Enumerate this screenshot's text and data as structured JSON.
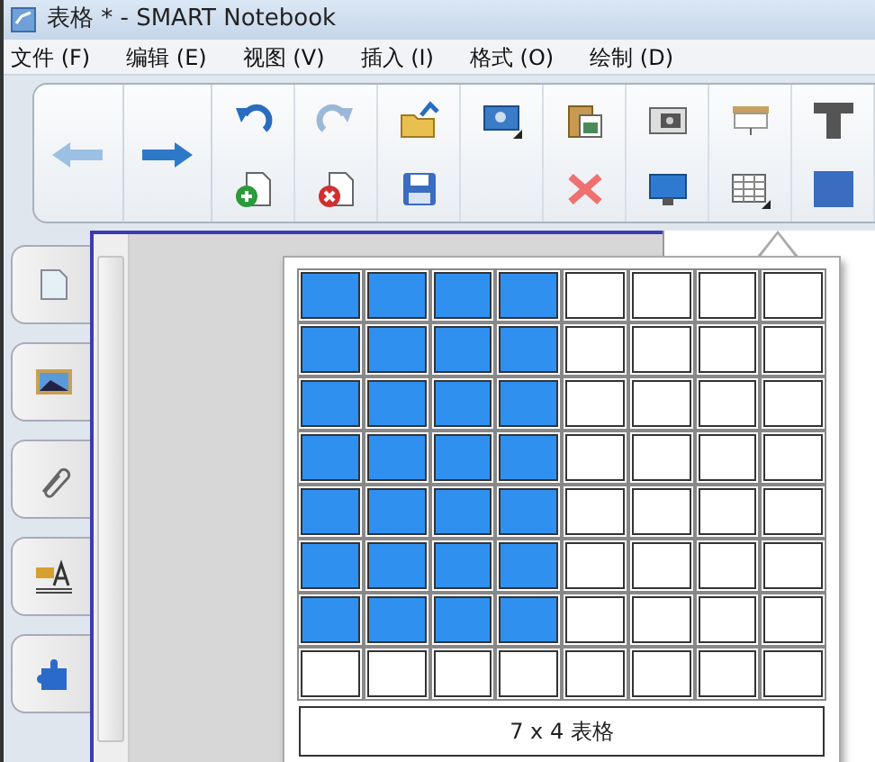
{
  "window": {
    "title": "表格 * - SMART Notebook"
  },
  "menu": [
    "文件 (F)",
    "编辑 (E)",
    "视图 (V)",
    "插入 (I)",
    "格式 (O)",
    "绘制 (D)"
  ],
  "table_picker": {
    "rows": [
      [
        {
          "selected": true
        },
        {
          "selected": true
        },
        {
          "selected": true
        },
        {
          "selected": true
        },
        {
          "selected": false
        },
        {
          "selected": false
        },
        {
          "selected": false
        },
        {
          "selected": false
        }
      ],
      [
        {
          "selected": true
        },
        {
          "selected": true
        },
        {
          "selected": true
        },
        {
          "selected": true
        },
        {
          "selected": false
        },
        {
          "selected": false
        },
        {
          "selected": false
        },
        {
          "selected": false
        }
      ],
      [
        {
          "selected": true
        },
        {
          "selected": true
        },
        {
          "selected": true
        },
        {
          "selected": true
        },
        {
          "selected": false
        },
        {
          "selected": false
        },
        {
          "selected": false
        },
        {
          "selected": false
        }
      ],
      [
        {
          "selected": true
        },
        {
          "selected": true
        },
        {
          "selected": true
        },
        {
          "selected": true
        },
        {
          "selected": false
        },
        {
          "selected": false
        },
        {
          "selected": false
        },
        {
          "selected": false
        }
      ],
      [
        {
          "selected": true
        },
        {
          "selected": true
        },
        {
          "selected": true
        },
        {
          "selected": true
        },
        {
          "selected": false
        },
        {
          "selected": false
        },
        {
          "selected": false
        },
        {
          "selected": false
        }
      ],
      [
        {
          "selected": true
        },
        {
          "selected": true
        },
        {
          "selected": true
        },
        {
          "selected": true
        },
        {
          "selected": false
        },
        {
          "selected": false
        },
        {
          "selected": false
        },
        {
          "selected": false
        }
      ],
      [
        {
          "selected": true
        },
        {
          "selected": true
        },
        {
          "selected": true
        },
        {
          "selected": true
        },
        {
          "selected": false
        },
        {
          "selected": false
        },
        {
          "selected": false
        },
        {
          "selected": false
        }
      ],
      [
        {
          "selected": false
        },
        {
          "selected": false
        },
        {
          "selected": false
        },
        {
          "selected": false
        },
        {
          "selected": false
        },
        {
          "selected": false
        },
        {
          "selected": false
        },
        {
          "selected": false
        }
      ]
    ],
    "size_label": "7 x 4 表格"
  }
}
